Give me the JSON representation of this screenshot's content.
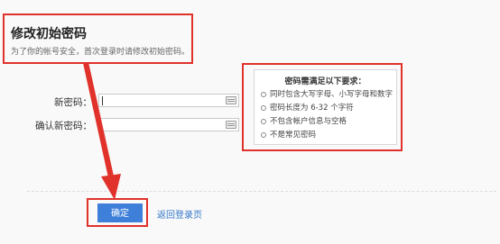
{
  "header": {
    "title": "修改初始密码",
    "subtitle": "为了你的帐号安全，首次登录时请修改初始密码。"
  },
  "form": {
    "new_password_label": "新密码：",
    "confirm_password_label": "确认新密码：",
    "new_password_value": "",
    "confirm_password_value": ""
  },
  "tooltip": {
    "title": "密码需满足以下要求：",
    "items": [
      "同时包含大写字母、小写字母和数字",
      "密码长度为 6-32 个字符",
      "不包含帐户信息与空格",
      "不是常见密码"
    ]
  },
  "actions": {
    "confirm_label": "确定",
    "back_label": "返回登录页"
  },
  "colors": {
    "annotation_red": "#e0322b",
    "primary_button": "#3e7fd9",
    "link": "#3476c8"
  },
  "icons": [
    "keyboard-icon",
    "radio-circle-icon",
    "annotation-arrow"
  ]
}
